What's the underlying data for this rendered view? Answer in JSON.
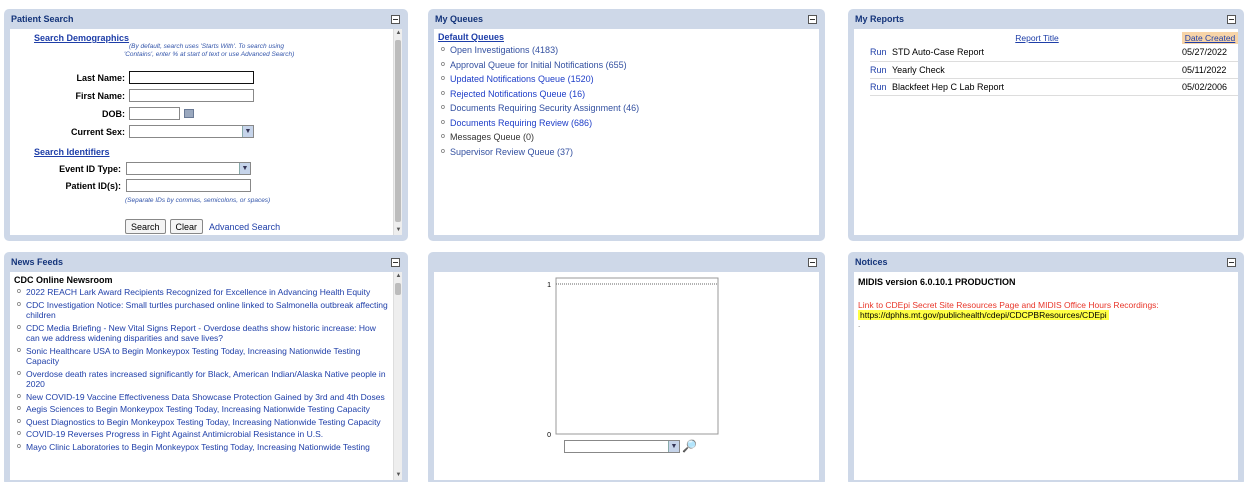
{
  "patient_search": {
    "title": "Patient Search",
    "search_demographics": "Search Demographics",
    "hint_demographics": [
      "(By default, search uses 'Starts With'. To search using",
      "'Contains', enter % at start of text or use Advanced Search)"
    ],
    "last_name_label": "Last Name:",
    "first_name_label": "First Name:",
    "dob_label": "DOB:",
    "current_sex_label": "Current Sex:",
    "search_identifiers": "Search Identifiers",
    "event_id_type_label": "Event ID Type:",
    "patient_ids_label": "Patient ID(s):",
    "hint_ids": "(Separate IDs by commas, semicolons, or spaces)",
    "search_button": "Search",
    "clear_button": "Clear",
    "advanced_search": "Advanced Search"
  },
  "my_queues": {
    "title": "My Queues",
    "default_queues": "Default Queues",
    "items": [
      {
        "label": "Open Investigations (4183)",
        "style": "normal"
      },
      {
        "label": "Approval Queue for Initial Notifications (655)",
        "style": "normal"
      },
      {
        "label": "Updated Notifications Queue (1520)",
        "style": "bright"
      },
      {
        "label": "Rejected Notifications Queue (16)",
        "style": "bright"
      },
      {
        "label": "Documents Requiring Security Assignment (46)",
        "style": "normal"
      },
      {
        "label": "Documents Requiring Review (686)",
        "style": "bright"
      },
      {
        "label": "Messages Queue (0)",
        "style": "grey"
      },
      {
        "label": "Supervisor Review Queue (37)",
        "style": "normal"
      }
    ]
  },
  "my_reports": {
    "title": "My Reports",
    "col_title": "Report Title",
    "col_date": "Date Created",
    "run_label": "Run",
    "rows": [
      {
        "title": "STD Auto-Case Report",
        "date": "05/27/2022"
      },
      {
        "title": "Yearly Check",
        "date": "05/11/2022"
      },
      {
        "title": "Blackfeet Hep C Lab Report",
        "date": "05/02/2006"
      }
    ]
  },
  "news_feeds": {
    "title": "News Feeds",
    "source": "CDC Online Newsroom",
    "items": [
      "2022 REACH Lark Award Recipients Recognized for Excellence in Advancing Health Equity",
      "CDC Investigation Notice: Small turtles purchased online linked to Salmonella outbreak affecting children",
      "CDC Media Briefing - New Vital Signs Report - Overdose deaths show historic increase: How can we address widening disparities and save lives?",
      "Sonic Healthcare USA to Begin Monkeypox Testing Today, Increasing Nationwide Testing Capacity",
      "Overdose death rates increased significantly for Black, American Indian/Alaska Native people in 2020",
      "New COVID-19 Vaccine Effectiveness Data Showcase Protection Gained by 3rd and 4th Doses",
      "Aegis Sciences to Begin Monkeypox Testing Today, Increasing Nationwide Testing Capacity",
      "Quest Diagnostics to Begin Monkeypox Testing Today, Increasing Nationwide Testing Capacity",
      "COVID-19 Reverses Progress in Fight Against Antimicrobial Resistance in U.S.",
      "Mayo Clinic Laboratories to Begin Monkeypox Testing Today, Increasing Nationwide Testing"
    ]
  },
  "chart_panel": {
    "chart_data": {
      "type": "bar",
      "categories": [],
      "values": [],
      "ylim": [
        0,
        1
      ],
      "y_ticks": [
        "1",
        "0"
      ]
    }
  },
  "notices": {
    "title": "Notices",
    "version": "MIDIS version 6.0.10.1 PRODUCTION",
    "link_text": "Link to CDEpi Secret Site Resources Page and MIDIS Office Hours Recordings:",
    "url": "https://dphhs.mt.gov/publichealth/cdepi/CDCPBResources/CDEpi",
    "trailing": "."
  },
  "colors": {
    "panel_bg": "#ced8e8",
    "title_color": "#14347a",
    "link_color": "#1e3ea8",
    "notice_red": "#e8362a",
    "highlight": "#ffff44",
    "date_header_bg": "#f7d4a8"
  }
}
